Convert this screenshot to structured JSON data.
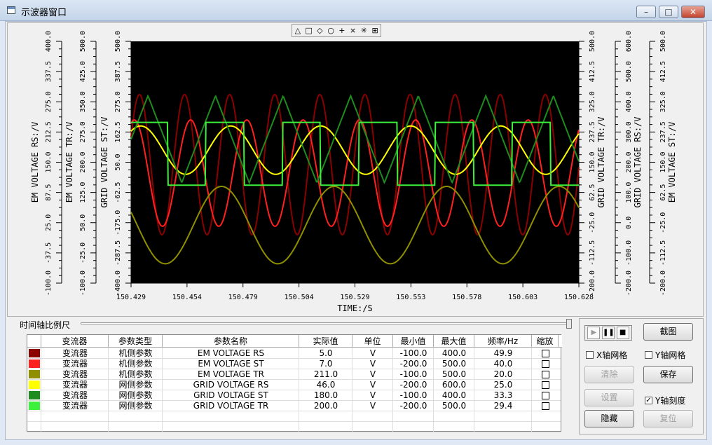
{
  "window": {
    "title": "示波器窗口",
    "minimize": "–",
    "maximize": "□",
    "close": "✕"
  },
  "toolbar": {
    "tools": [
      "△",
      "□",
      "◇",
      "○",
      "+",
      "×",
      "✳",
      "⊞"
    ]
  },
  "chart_data": {
    "type": "line",
    "xlabel": "TIME:/S",
    "x_ticks": [
      "150.429",
      "150.454",
      "150.479",
      "150.504",
      "150.529",
      "150.553",
      "150.578",
      "150.603",
      "150.628"
    ],
    "left_axes": [
      {
        "label": "EM VOLTAGE RS:/V",
        "ticks": [
          "400.0",
          "337.5",
          "275.0",
          "212.5",
          "150.0",
          "87.5",
          "25.0",
          "-37.5",
          "-100.0"
        ]
      },
      {
        "label": "EM VOLTAGE TR:/V",
        "ticks": [
          "500.0",
          "425.0",
          "350.0",
          "275.0",
          "200.0",
          "125.0",
          "50.0",
          "-25.0",
          "-100.0"
        ]
      },
      {
        "label": "GRID VOLTAGE ST:/V",
        "ticks": [
          "500.0",
          "387.5",
          "275.0",
          "162.5",
          "50.0",
          "-62.5",
          "-175.0",
          "-287.5",
          "-400.0"
        ]
      }
    ],
    "right_axes": [
      {
        "label": "GRID VOLTAGE TR:/V",
        "ticks": [
          "500.0",
          "412.5",
          "325.0",
          "237.5",
          "150.0",
          "62.5",
          "-25.0",
          "-112.5",
          "-200.0"
        ]
      },
      {
        "label": "GRID VOLTAGE RS:/V",
        "ticks": [
          "600.0",
          "500.0",
          "400.0",
          "300.0",
          "200.0",
          "100.0",
          "0.0",
          "-100.0",
          "-200.0"
        ]
      },
      {
        "label": "EM VOLTAGE ST:/V",
        "ticks": [
          "500.0",
          "412.5",
          "325.0",
          "237.5",
          "150.0",
          "62.5",
          "-25.0",
          "-112.5",
          "-200.0"
        ]
      }
    ],
    "series": [
      {
        "name": "EM VOLTAGE RS",
        "color": "#8b0000",
        "shape": "sine",
        "freq": 49.9,
        "amp": 0.58,
        "offset": -0.02,
        "phase": 0.4
      },
      {
        "name": "EM VOLTAGE ST",
        "color": "#ff2020",
        "shape": "sine",
        "freq": 40.0,
        "amp": 0.44,
        "offset": -0.09,
        "phase": 1.2
      },
      {
        "name": "EM VOLTAGE TR",
        "color": "#8f8f00",
        "shape": "sine",
        "freq": 20.0,
        "amp": 0.32,
        "offset": -0.52,
        "phase": 2.8
      },
      {
        "name": "GRID VOLTAGE RS",
        "color": "#ffff00",
        "shape": "sine",
        "freq": 25.0,
        "amp": 0.2,
        "offset": 0.1,
        "phase": 0.9
      },
      {
        "name": "GRID VOLTAGE ST",
        "color": "#1e8c1e",
        "shape": "triangle",
        "freq": 33.3,
        "amp": 0.36,
        "offset": 0.19,
        "phase": 0.0
      },
      {
        "name": "GRID VOLTAGE TR",
        "color": "#3cf03c",
        "shape": "square",
        "freq": 29.4,
        "amp": 0.26,
        "offset": 0.07,
        "phase": 0.15
      }
    ]
  },
  "scale": {
    "label": "时间轴比例尺"
  },
  "table": {
    "headers": [
      "",
      "变流器",
      "参数类型",
      "参数名称",
      "实际值",
      "单位",
      "最小值",
      "最大值",
      "频率/Hz",
      "缩放"
    ],
    "rows": [
      {
        "color": "#8b0000",
        "device": "变流器",
        "type": "机侧参数",
        "name": "EM VOLTAGE RS",
        "value": "5.0",
        "unit": "V",
        "min": "-100.0",
        "max": "400.0",
        "freq": "49.9"
      },
      {
        "color": "#ff2020",
        "device": "变流器",
        "type": "机侧参数",
        "name": "EM VOLTAGE ST",
        "value": "7.0",
        "unit": "V",
        "min": "-200.0",
        "max": "500.0",
        "freq": "40.0"
      },
      {
        "color": "#8f8f00",
        "device": "变流器",
        "type": "机侧参数",
        "name": "EM VOLTAGE TR",
        "value": "211.0",
        "unit": "V",
        "min": "-100.0",
        "max": "500.0",
        "freq": "20.0"
      },
      {
        "color": "#ffff00",
        "device": "变流器",
        "type": "网侧参数",
        "name": "GRID VOLTAGE RS",
        "value": "46.0",
        "unit": "V",
        "min": "-200.0",
        "max": "600.0",
        "freq": "25.0"
      },
      {
        "color": "#1e8c1e",
        "device": "变流器",
        "type": "网侧参数",
        "name": "GRID VOLTAGE ST",
        "value": "180.0",
        "unit": "V",
        "min": "-100.0",
        "max": "400.0",
        "freq": "33.3"
      },
      {
        "color": "#3cf03c",
        "device": "变流器",
        "type": "网侧参数",
        "name": "GRID VOLTAGE TR",
        "value": "200.0",
        "unit": "V",
        "min": "-200.0",
        "max": "500.0",
        "freq": "29.4"
      }
    ]
  },
  "controls": {
    "screenshot": "截图",
    "x_grid": "X轴网格",
    "y_grid": "Y轴网格",
    "clear": "清除",
    "save": "保存",
    "settings": "设置",
    "y_scale": "Y轴刻度",
    "hide": "隐藏",
    "reset": "复位"
  }
}
